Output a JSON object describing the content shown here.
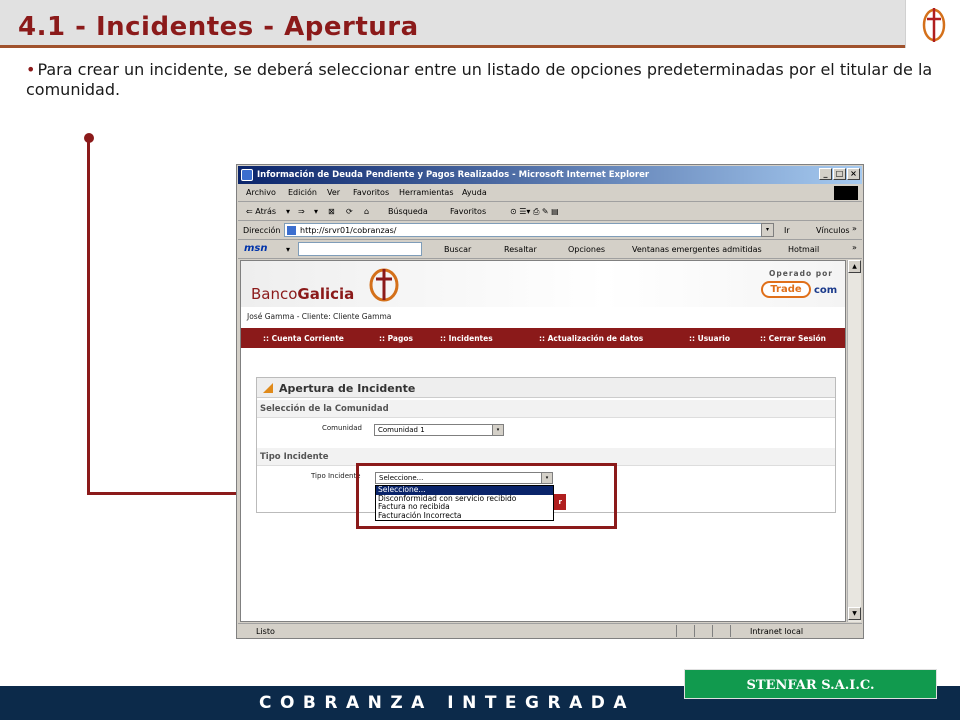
{
  "slide": {
    "title": "4.1 - Incidentes - Apertura",
    "intro": "Para crear un incidente, se deberá seleccionar entre un listado de opciones predeterminadas por el titular de la comunidad.",
    "bullet": "•",
    "footer_text": "COBRANZA INTEGRADA",
    "company": "STENFAR S.A.I.C.",
    "colors": {
      "accent": "#8b1a1a",
      "footer": "#0c2a4a",
      "company": "#119a4e"
    }
  },
  "browser": {
    "title": "Información de Deuda Pendiente y Pagos Realizados - Microsoft Internet Explorer",
    "window_buttons": [
      "_",
      "□",
      "×"
    ],
    "menu": [
      "Archivo",
      "Edición",
      "Ver",
      "Favoritos",
      "Herramientas",
      "Ayuda"
    ],
    "toolbar": {
      "back": "⇐ Atrás",
      "back_arrow": "▾",
      "forward": "⇒",
      "forward_arrow": "▾",
      "stop": "⊠",
      "refresh": "⟳",
      "home": "⌂",
      "search": "Búsqueda",
      "favorites": "Favoritos",
      "icons": "⊙  ☰▾  ⎙  ✎  ▤"
    },
    "address": {
      "label": "Dirección",
      "url": "http://srvr01/cobranzas/",
      "go": "Ir",
      "links": "Vínculos",
      "more": "»"
    },
    "msnbar": {
      "brand": "msn",
      "arrow": "▾",
      "search": "Buscar",
      "highlight": "Resaltar",
      "options": "Opciones",
      "popups": "Ventanas emergentes admitidas",
      "hotmail": "Hotmail",
      "more": "»"
    },
    "status": {
      "text": "Listo",
      "zone": "Intranet local"
    },
    "scroll": {
      "up": "▲",
      "down": "▼"
    }
  },
  "page": {
    "bank_prefix": "Banco",
    "bank_name": "Galicia",
    "operated_by": "Operado por",
    "trade": "Trade",
    "com": "com",
    "user_line": "José Gamma - Cliente: Cliente Gamma",
    "nav": [
      ":: Cuenta Corriente",
      ":: Pagos",
      ":: Incidentes",
      ":: Actualización de datos",
      ":: Usuario",
      ":: Cerrar Sesión"
    ],
    "panel_title": "Apertura de Incidente",
    "section_community": "Selección de la Comunidad",
    "community_label": "Comunidad",
    "community_value": "Comunidad 1",
    "section_type": "Tipo Incidente",
    "type_label": "Tipo Incidente",
    "type_value": "Seleccione...",
    "type_options": [
      "Seleccione...",
      "Disconformidad con servicio recibido",
      "Factura no recibida",
      "Facturación Incorrecta"
    ],
    "button_partial": "r",
    "dropdown_arrow": "▾"
  }
}
